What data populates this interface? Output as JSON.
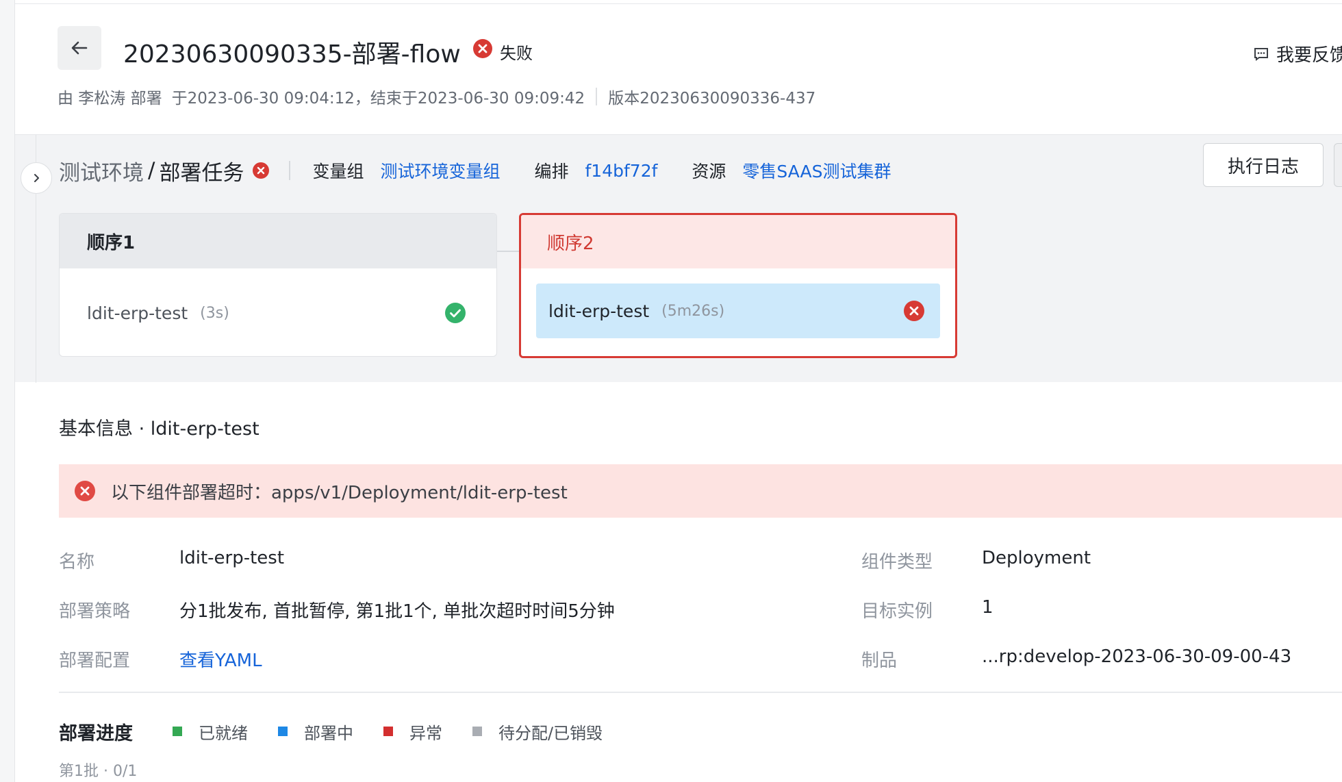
{
  "header": {
    "title": "20230630090335-部署-flow",
    "status": "失败",
    "feedback": "我要反馈",
    "deployer": "由 李松涛 部署",
    "time_range": "于2023-06-30 09:04:12，结束于2023-06-30 09:09:42",
    "version": "版本20230630090336-437"
  },
  "env": {
    "name": "测试环境",
    "slash": "/",
    "task": "部署任务",
    "var_group_label": "变量组",
    "var_group_value": "测试环境变量组",
    "orchestration_label": "编排",
    "orchestration_value": "f14bf72f",
    "resource_label": "资源",
    "resource_value": "零售SAAS测试集群",
    "log_button": "执行日志"
  },
  "sequences": [
    {
      "title": "顺序1",
      "task": "ldit-erp-test",
      "duration": "(3s)",
      "status": "success"
    },
    {
      "title": "顺序2",
      "task": "ldit-erp-test",
      "duration": "(5m26s)",
      "status": "failed"
    }
  ],
  "detail": {
    "section_title": "基本信息 · ldit-erp-test",
    "alert": "以下组件部署超时：apps/v1/Deployment/ldit-erp-test",
    "name_label": "名称",
    "name_value": "ldit-erp-test",
    "strategy_label": "部署策略",
    "strategy_value": "分1批发布, 首批暂停, 第1批1个, 单批次超时时间5分钟",
    "config_label": "部署配置",
    "config_value": "查看YAML",
    "type_label": "组件类型",
    "type_value": "Deployment",
    "target_label": "目标实例",
    "target_value": "1",
    "artifact_label": "制品",
    "artifact_value": "...rp:develop-2023-06-30-09-00-43"
  },
  "progress": {
    "title": "部署进度",
    "legend": [
      {
        "label": "已就绪",
        "color": "#34a853"
      },
      {
        "label": "部署中",
        "color": "#1e88e5"
      },
      {
        "label": "异常",
        "color": "#d32f2f"
      },
      {
        "label": "待分配/已销毁",
        "color": "#a9adb3"
      }
    ],
    "batch": "第1批 · 0/1"
  },
  "colors": {
    "link": "#1664d9",
    "error": "#d73a34",
    "success": "#34b36b"
  }
}
